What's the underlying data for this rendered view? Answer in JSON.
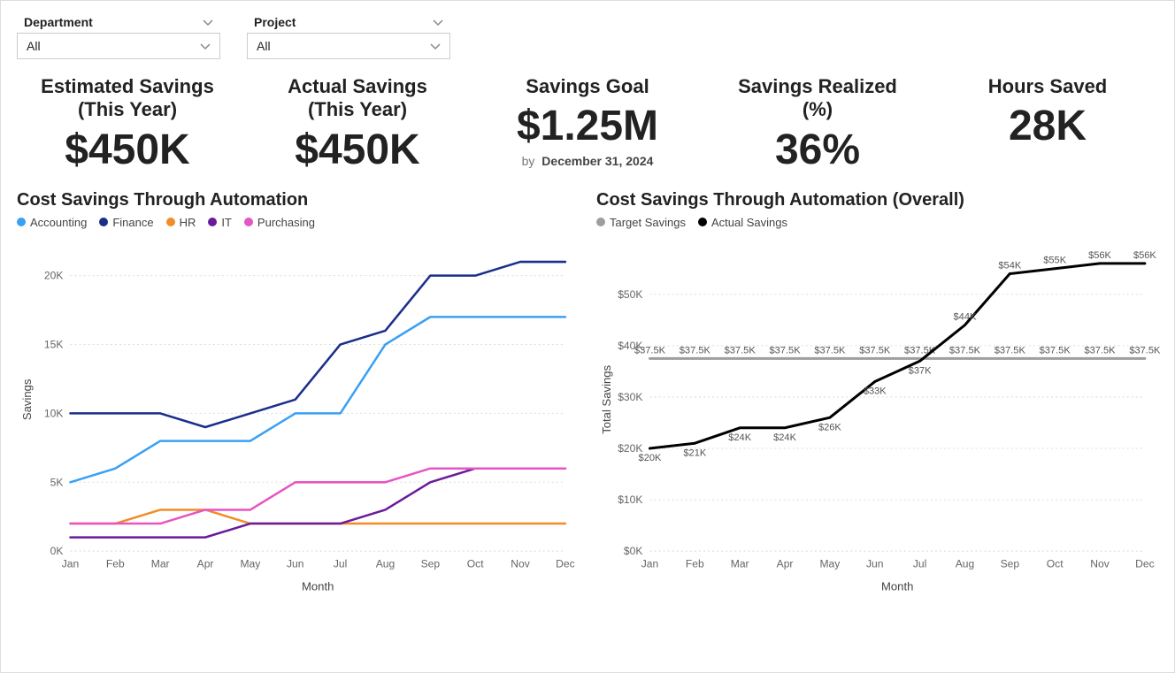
{
  "filters": {
    "department": {
      "label": "Department",
      "value": "All"
    },
    "project": {
      "label": "Project",
      "value": "All"
    }
  },
  "kpis": {
    "estimated": {
      "label1": "Estimated Savings",
      "label2": "(This Year)",
      "value": "$450K"
    },
    "actual": {
      "label1": "Actual Savings",
      "label2": "(This Year)",
      "value": "$450K"
    },
    "goal": {
      "label1": "Savings Goal",
      "value": "$1.25M",
      "by_prefix": "by",
      "by_date": "December 31, 2024"
    },
    "realized": {
      "label1": "Savings Realized",
      "label2": "(%)",
      "value": "36%"
    },
    "hours": {
      "label1": "Hours Saved",
      "value": "28K"
    }
  },
  "chart1": {
    "title": "Cost Savings Through Automation",
    "xlabel": "Month",
    "ylabel": "Savings",
    "categories": [
      "Jan",
      "Feb",
      "Mar",
      "Apr",
      "May",
      "Jun",
      "Jul",
      "Aug",
      "Sep",
      "Oct",
      "Nov",
      "Dec"
    ],
    "yticks": [
      0,
      5,
      10,
      15,
      20
    ],
    "ytick_labels": [
      "0K",
      "5K",
      "10K",
      "15K",
      "20K"
    ],
    "series": [
      {
        "name": "Accounting",
        "color": "#3AA0F3",
        "values": [
          5,
          6,
          8,
          8,
          8,
          10,
          10,
          15,
          17,
          17,
          17,
          17
        ]
      },
      {
        "name": "Finance",
        "color": "#1B2E8B",
        "values": [
          10,
          10,
          10,
          9,
          10,
          11,
          15,
          16,
          20,
          20,
          21,
          21
        ]
      },
      {
        "name": "HR",
        "color": "#F28C28",
        "values": [
          2,
          2,
          3,
          3,
          2,
          2,
          2,
          2,
          2,
          2,
          2,
          2
        ]
      },
      {
        "name": "IT",
        "color": "#6A1B9A",
        "values": [
          1,
          1,
          1,
          1,
          2,
          2,
          2,
          3,
          5,
          6,
          6,
          6
        ]
      },
      {
        "name": "Purchasing",
        "color": "#E754C4",
        "values": [
          2,
          2,
          2,
          3,
          3,
          5,
          5,
          5,
          6,
          6,
          6,
          6
        ]
      }
    ]
  },
  "chart2": {
    "title": "Cost Savings Through Automation (Overall)",
    "xlabel": "Month",
    "ylabel": "Total Savings",
    "categories": [
      "Jan",
      "Feb",
      "Mar",
      "Apr",
      "May",
      "Jun",
      "Jul",
      "Aug",
      "Sep",
      "Oct",
      "Nov",
      "Dec"
    ],
    "yticks": [
      0,
      10,
      20,
      30,
      40,
      50
    ],
    "ytick_labels": [
      "$0K",
      "$10K",
      "$20K",
      "$30K",
      "$40K",
      "$50K"
    ],
    "series": [
      {
        "name": "Target Savings",
        "color": "#9e9e9e",
        "values": [
          37.5,
          37.5,
          37.5,
          37.5,
          37.5,
          37.5,
          37.5,
          37.5,
          37.5,
          37.5,
          37.5,
          37.5
        ],
        "labels": [
          "$37.5K",
          "$37.5K",
          "$37.5K",
          "$37.5K",
          "$37.5K",
          "$37.5K",
          "$37.5K",
          "$37.5K",
          "$37.5K",
          "$37.5K",
          "$37.5K",
          "$37.5K"
        ]
      },
      {
        "name": "Actual Savings",
        "color": "#000000",
        "values": [
          20,
          21,
          24,
          24,
          26,
          33,
          37,
          44,
          54,
          55,
          56,
          56
        ],
        "labels": [
          "$20K",
          "$21K",
          "$24K",
          "$24K",
          "$26K",
          "$33K",
          "$37K",
          "$44K",
          "$54K",
          "$55K",
          "$56K",
          "$56K"
        ]
      }
    ]
  },
  "chart_data": [
    {
      "type": "line",
      "title": "Cost Savings Through Automation",
      "xlabel": "Month",
      "ylabel": "Savings",
      "ylim": [
        0,
        22
      ],
      "categories": [
        "Jan",
        "Feb",
        "Mar",
        "Apr",
        "May",
        "Jun",
        "Jul",
        "Aug",
        "Sep",
        "Oct",
        "Nov",
        "Dec"
      ],
      "series": [
        {
          "name": "Accounting",
          "values": [
            5,
            6,
            8,
            8,
            8,
            10,
            10,
            15,
            17,
            17,
            17,
            17
          ]
        },
        {
          "name": "Finance",
          "values": [
            10,
            10,
            10,
            9,
            10,
            11,
            15,
            16,
            20,
            20,
            21,
            21
          ]
        },
        {
          "name": "HR",
          "values": [
            2,
            2,
            3,
            3,
            2,
            2,
            2,
            2,
            2,
            2,
            2,
            2
          ]
        },
        {
          "name": "IT",
          "values": [
            1,
            1,
            1,
            1,
            2,
            2,
            2,
            3,
            5,
            6,
            6,
            6
          ]
        },
        {
          "name": "Purchasing",
          "values": [
            2,
            2,
            2,
            3,
            3,
            5,
            5,
            5,
            6,
            6,
            6,
            6
          ]
        }
      ]
    },
    {
      "type": "line",
      "title": "Cost Savings Through Automation (Overall)",
      "xlabel": "Month",
      "ylabel": "Total Savings",
      "ylim": [
        0,
        60
      ],
      "categories": [
        "Jan",
        "Feb",
        "Mar",
        "Apr",
        "May",
        "Jun",
        "Jul",
        "Aug",
        "Sep",
        "Oct",
        "Nov",
        "Dec"
      ],
      "series": [
        {
          "name": "Target Savings",
          "values": [
            37.5,
            37.5,
            37.5,
            37.5,
            37.5,
            37.5,
            37.5,
            37.5,
            37.5,
            37.5,
            37.5,
            37.5
          ]
        },
        {
          "name": "Actual Savings",
          "values": [
            20,
            21,
            24,
            24,
            26,
            33,
            37,
            44,
            54,
            55,
            56,
            56
          ]
        }
      ]
    }
  ]
}
